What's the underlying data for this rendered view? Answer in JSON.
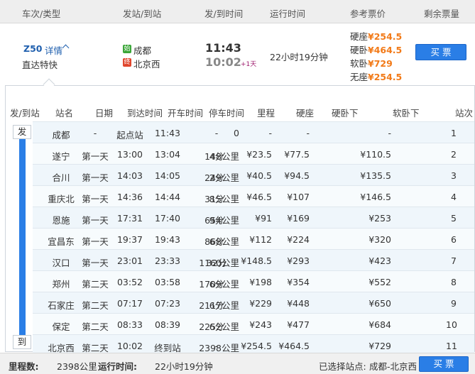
{
  "header": {
    "col_train": "车次/类型",
    "col_stations": "发站/到站",
    "col_times": "发/到时间",
    "col_duration": "运行时间",
    "col_price": "参考票价",
    "col_tickets": "剩余票量"
  },
  "train": {
    "code": "Z50",
    "detail_label": "详情",
    "type": "直达特快",
    "from_badge": "始",
    "from": "成都",
    "to_badge": "终",
    "to": "北京西",
    "depart": "11:43",
    "arrive": "10:02",
    "plus_day": "+1天",
    "duration": "22小时19分钟",
    "prices": [
      {
        "label": "硬座",
        "value": "¥254.5"
      },
      {
        "label": "硬卧",
        "value": "¥464.5"
      },
      {
        "label": "软卧",
        "value": "¥729"
      },
      {
        "label": "无座",
        "value": "¥254.5"
      }
    ],
    "buy_label": "买 票",
    "accent_color": "#f27a18",
    "button_color": "#2a7ee6"
  },
  "detail": {
    "columns": [
      "发/到站",
      "站名",
      "日期",
      "到达时间",
      "开车时间",
      "停车时间",
      "里程",
      "硬座",
      "硬卧下",
      "软卧下",
      "站次"
    ],
    "depart_marker": "发",
    "arrive_marker": "到",
    "rows": [
      [
        "成都",
        "-",
        "起点站",
        "11:43",
        "-",
        "0",
        "-",
        "-",
        "-",
        "1"
      ],
      [
        "遂宁",
        "第一天",
        "13:00",
        "13:04",
        "4分",
        "148公里",
        "¥23.5",
        "¥77.5",
        "¥110.5",
        "2"
      ],
      [
        "合川",
        "第一天",
        "14:03",
        "14:05",
        "2分",
        "249公里",
        "¥40.5",
        "¥94.5",
        "¥135.5",
        "3"
      ],
      [
        "重庆北",
        "第一天",
        "14:36",
        "14:44",
        "8分",
        "315公里",
        "¥46.5",
        "¥107",
        "¥146.5",
        "4"
      ],
      [
        "恩施",
        "第一天",
        "17:31",
        "17:40",
        "9分",
        "654公里",
        "¥91",
        "¥169",
        "¥253",
        "5"
      ],
      [
        "宜昌东",
        "第一天",
        "19:37",
        "19:43",
        "6分",
        "868公里",
        "¥112",
        "¥224",
        "¥320",
        "6"
      ],
      [
        "汉口",
        "第一天",
        "23:01",
        "23:33",
        "32分",
        "1160公里",
        "¥148.5",
        "¥293",
        "¥423",
        "7"
      ],
      [
        "郑州",
        "第二天",
        "03:52",
        "03:58",
        "6分",
        "1709公里",
        "¥198",
        "¥354",
        "¥552",
        "8"
      ],
      [
        "石家庄",
        "第二天",
        "07:17",
        "07:23",
        "6分",
        "2117公里",
        "¥229",
        "¥448",
        "¥650",
        "9"
      ],
      [
        "保定",
        "第二天",
        "08:33",
        "08:39",
        "6分",
        "2252公里",
        "¥243",
        "¥477",
        "¥684",
        "10"
      ],
      [
        "北京西",
        "第二天",
        "10:02",
        "终到站",
        "-",
        "2398公里",
        "¥254.5",
        "¥464.5",
        "¥729",
        "11"
      ]
    ]
  },
  "footer": {
    "distance_label": "里程数:",
    "distance": "2398公里",
    "runtime_label": "运行时间:",
    "runtime": "22小时19分钟",
    "selected_label": "已选择站点:",
    "selected": "成都-北京西",
    "buy_label": "买 票"
  }
}
